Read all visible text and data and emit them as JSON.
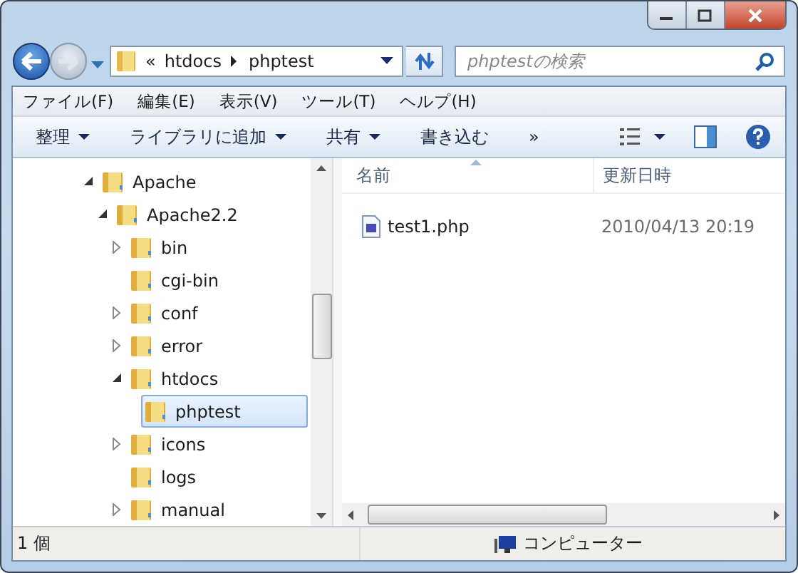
{
  "address_bar": {
    "segments": [
      "«",
      "htdocs",
      "phptest"
    ]
  },
  "search": {
    "placeholder": "phptestの検索"
  },
  "menu_bar": [
    "ファイル(F)",
    "編集(E)",
    "表示(V)",
    "ツール(T)",
    "ヘルプ(H)"
  ],
  "toolbar": [
    {
      "label": "整理",
      "dropdown": true
    },
    {
      "label": "ライブラリに追加",
      "dropdown": true
    },
    {
      "label": "共有",
      "dropdown": true
    },
    {
      "label": "書き込む",
      "dropdown": false
    },
    {
      "label": "»",
      "dropdown": false
    }
  ],
  "tree": [
    {
      "label": "Apache",
      "expanded": true,
      "selected": false,
      "children": [
        {
          "label": "Apache2.2",
          "expanded": true,
          "selected": false,
          "children": [
            {
              "label": "bin",
              "expanded": false,
              "selected": false
            },
            {
              "label": "cgi-bin",
              "selected": false
            },
            {
              "label": "conf",
              "expanded": false,
              "selected": false
            },
            {
              "label": "error",
              "expanded": false,
              "selected": false
            },
            {
              "label": "htdocs",
              "expanded": true,
              "selected": false,
              "children": [
                {
                  "label": "phptest",
                  "selected": true
                }
              ]
            },
            {
              "label": "icons",
              "expanded": false,
              "selected": false
            },
            {
              "label": "logs",
              "selected": false
            },
            {
              "label": "manual",
              "expanded": false,
              "selected": false
            }
          ]
        }
      ]
    }
  ],
  "file_list": {
    "columns": [
      "名前",
      "更新日時"
    ],
    "rows": [
      {
        "name": "test1.php",
        "modified": "2010/04/13 20:19"
      }
    ]
  },
  "status_bar": {
    "count": "1 個",
    "location": "コンピューター"
  }
}
